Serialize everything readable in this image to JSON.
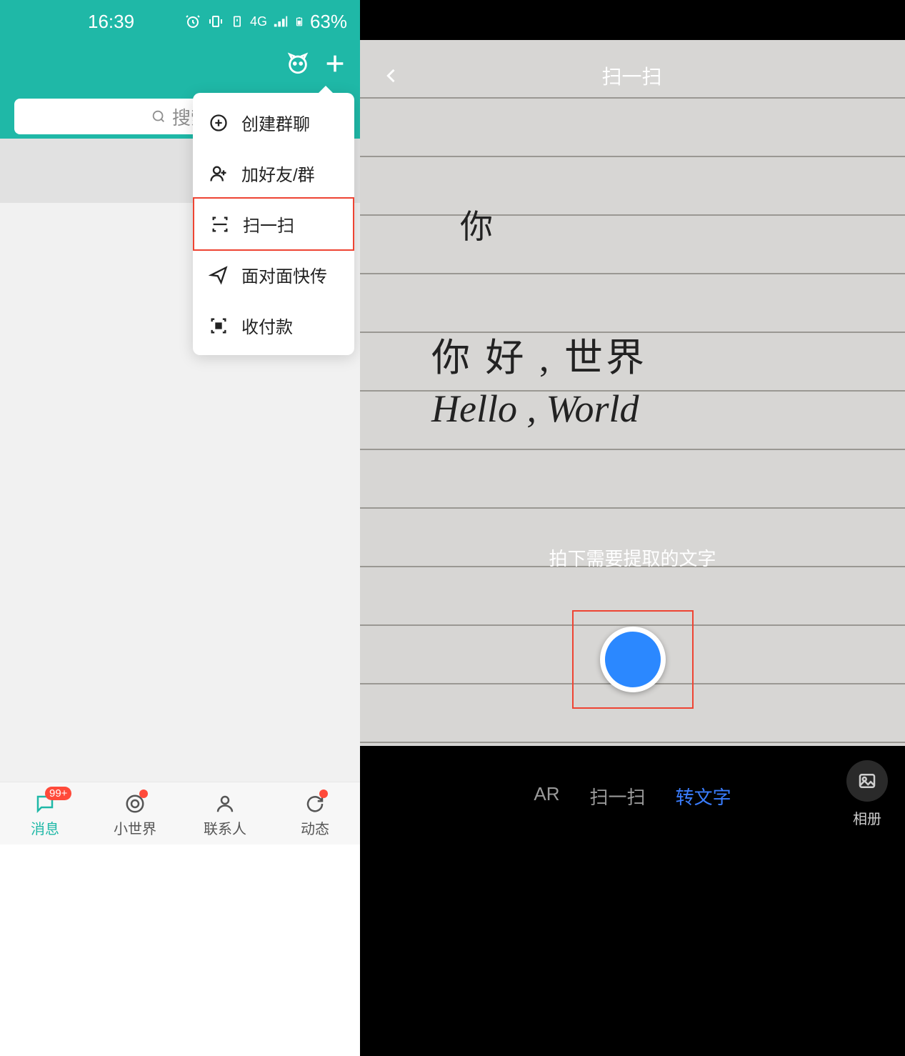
{
  "statusbar": {
    "time": "16:39",
    "battery": "63%",
    "netlabel": "4G"
  },
  "search": {
    "placeholder": "搜索"
  },
  "dropdown": {
    "items": [
      {
        "label": "创建群聊"
      },
      {
        "label": "加好友/群"
      },
      {
        "label": "扫一扫"
      },
      {
        "label": "面对面快传"
      },
      {
        "label": "收付款"
      }
    ]
  },
  "tabs": [
    {
      "label": "消息",
      "badge": "99+"
    },
    {
      "label": "小世界"
    },
    {
      "label": "联系人"
    },
    {
      "label": "动态"
    }
  ],
  "scanner": {
    "title": "扫一扫",
    "hint": "拍下需要提取的文字",
    "handwriting": {
      "scribble": "你",
      "line1": "你 好 , 世界",
      "line2": "Hello , World"
    },
    "modes": [
      {
        "label": "AR"
      },
      {
        "label": "扫一扫"
      },
      {
        "label": "转文字"
      }
    ],
    "album": "相册"
  }
}
